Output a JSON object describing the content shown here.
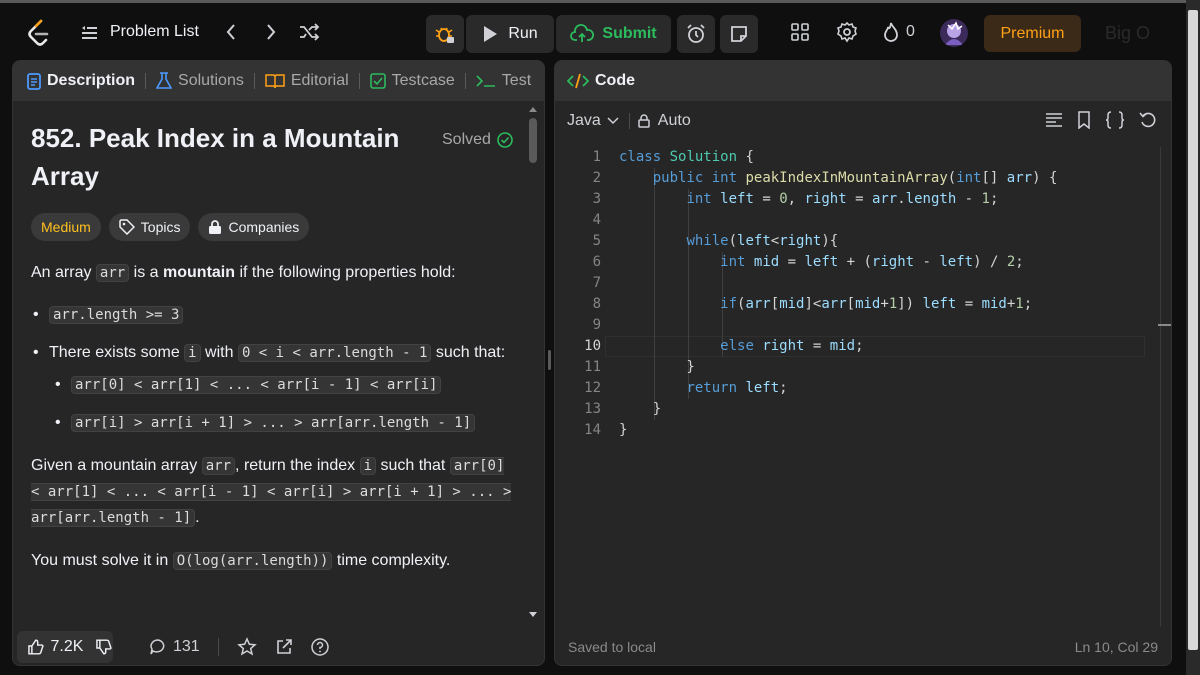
{
  "topbar": {
    "problem_list": "Problem List",
    "run_label": "Run",
    "submit_label": "Submit",
    "streak_count": "0",
    "premium_label": "Premium",
    "bigo_label": "Big O"
  },
  "left_tabs": {
    "description": "Description",
    "solutions": "Solutions",
    "editorial": "Editorial",
    "testcase": "Testcase",
    "test": "Test"
  },
  "problem": {
    "title": "852. Peak Index in a Mountain Array",
    "status": "Solved",
    "difficulty": "Medium",
    "topics": "Topics",
    "companies": "Companies",
    "intro_1": "An array ",
    "intro_code": "arr",
    "intro_2": " is a ",
    "intro_bold": "mountain",
    "intro_3": " if the following properties hold:",
    "prop1_code": "arr.length >= 3",
    "prop2_1": "There exists some ",
    "prop2_code1": "i",
    "prop2_2": " with ",
    "prop2_code2": "0 < i < arr.length - 1",
    "prop2_3": " such that:",
    "sub1_code": "arr[0] < arr[1] < ... < arr[i - 1] < arr[i]",
    "sub2_code": "arr[i] > arr[i + 1] > ... > arr[arr.length - 1]",
    "given_1": "Given a mountain array ",
    "given_code1": "arr",
    "given_2": ", return the index ",
    "given_code2": "i",
    "given_3": " such that ",
    "given_code3": "arr[0] < arr[1] < ... < arr[i - 1] < arr[i] > arr[i + 1] > ... > arr[arr.length - 1]",
    "given_4": ".",
    "must_1": "You must solve it in ",
    "must_code": "O(log(arr.length))",
    "must_2": " time complexity."
  },
  "left_bottom": {
    "likes": "7.2K",
    "comments": "131"
  },
  "code_panel": {
    "tab_label": "Code",
    "language": "Java",
    "mode": "Auto",
    "saved": "Saved to local",
    "cursor": "Ln 10, Col 29"
  },
  "code_lines": [
    "class Solution {",
    "    public int peakIndexInMountainArray(int[] arr) {",
    "        int left = 0, right = arr.length - 1;",
    "",
    "        while(left<right){",
    "            int mid = left + (right - left) / 2;",
    "",
    "            if(arr[mid]<arr[mid+1]) left = mid+1;",
    "",
    "            else right = mid;",
    "        }",
    "        return left;",
    "    }",
    "}"
  ],
  "colors": {
    "accent_orange": "#ffa116",
    "submit_green": "#2cbb5d",
    "medium_yellow": "#ffc01e"
  }
}
